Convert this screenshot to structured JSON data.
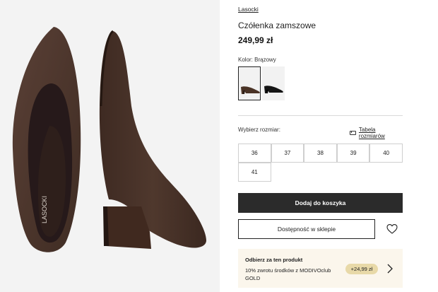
{
  "product": {
    "brand": "Lasocki",
    "title": "Czółenka zamszowe",
    "price": "249,99 zł",
    "sole_logo": "LASOCKI"
  },
  "color": {
    "label": "Kolor: Brązowy",
    "swatches": [
      {
        "name": "Brązowy",
        "hex": "#4a3326",
        "selected": true
      },
      {
        "name": "Czarny",
        "hex": "#151515",
        "selected": false
      }
    ]
  },
  "sizes": {
    "label": "Wybierz rozmiar:",
    "table_link": "Tabela rozmiarów",
    "options": [
      "36",
      "37",
      "38",
      "39",
      "40",
      "41"
    ]
  },
  "actions": {
    "add_to_cart": "Dodaj do koszyka",
    "availability": "Dostępność w sklepie",
    "wishlist_icon": "heart-icon"
  },
  "promo": {
    "title": "Odbierz za ten produkt",
    "text": "10% zwrotu środków z MODIVOclub GOLD",
    "badge": "+24,99 zł"
  },
  "colors": {
    "suede_brown": "#4b352c",
    "button_dark": "#2b2b2b",
    "promo_bg": "#fbf6ec",
    "badge_bg": "#e8d9a8"
  }
}
